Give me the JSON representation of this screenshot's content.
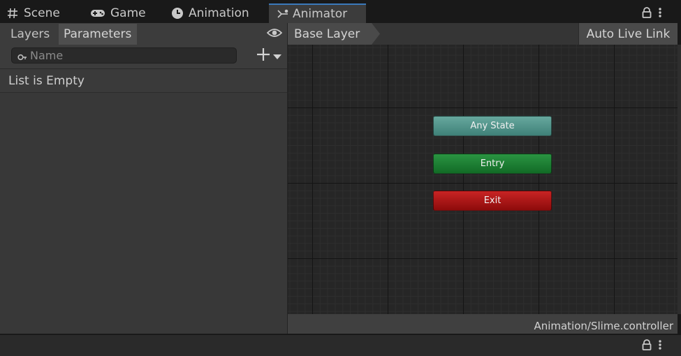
{
  "tabs": [
    {
      "label": "Scene",
      "icon": "grid-icon"
    },
    {
      "label": "Game",
      "icon": "gamepad-icon"
    },
    {
      "label": "Animation",
      "icon": "clock-icon"
    },
    {
      "label": "Animator",
      "icon": "animator-icon",
      "active": true
    }
  ],
  "left_panel": {
    "subtabs": [
      "Layers",
      "Parameters"
    ],
    "active_subtab": "Parameters",
    "search": {
      "placeholder": "Name",
      "value": ""
    },
    "empty_message": "List is Empty"
  },
  "graph": {
    "breadcrumb": "Base Layer",
    "live_link_label": "Auto Live Link",
    "nodes": [
      {
        "label": "Any State",
        "color": "#4f9289"
      },
      {
        "label": "Entry",
        "color": "#1a7f33"
      },
      {
        "label": "Exit",
        "color": "#ad1515"
      }
    ],
    "footer_path": "Animation/Slime.controller"
  },
  "colors": {
    "active_tab_accent": "#3a79bb",
    "panel_bg": "#383838",
    "graph_bg": "#262626"
  }
}
